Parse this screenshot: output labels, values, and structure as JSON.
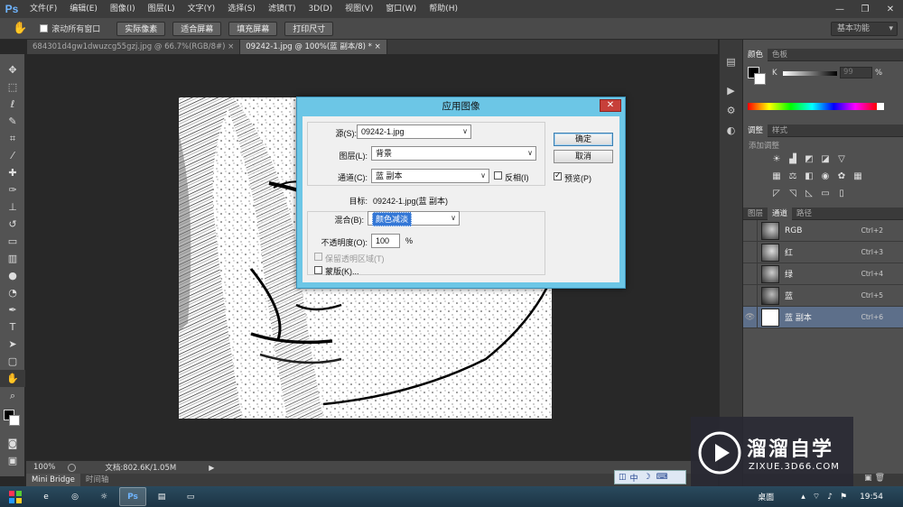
{
  "app": {
    "logo": "Ps"
  },
  "menu": [
    "文件(F)",
    "编辑(E)",
    "图像(I)",
    "图层(L)",
    "文字(Y)",
    "选择(S)",
    "滤镜(T)",
    "3D(D)",
    "视图(V)",
    "窗口(W)",
    "帮助(H)"
  ],
  "window_controls": {
    "minimize": "—",
    "restore": "❐",
    "close": "✕"
  },
  "options": {
    "scroll_all_label": "滚动所有窗口",
    "buttons": [
      "实际像素",
      "适合屏幕",
      "填充屏幕",
      "打印尺寸"
    ],
    "workspace": "基本功能"
  },
  "doc_tabs": [
    {
      "title": "684301d4gw1dwuzcg55gzj.jpg @ 66.7%(RGB/8#)",
      "close": "×"
    },
    {
      "title": "09242-1.jpg @ 100%(蓝 副本/8) *",
      "close": "×"
    }
  ],
  "tools": [
    "move-icon",
    "marquee-icon",
    "lasso-icon",
    "quick-select-icon",
    "crop-icon",
    "eyedropper-icon",
    "healing-icon",
    "brush-icon",
    "stamp-icon",
    "history-brush-icon",
    "eraser-icon",
    "gradient-icon",
    "blur-icon",
    "dodge-icon",
    "pen-icon",
    "type-icon",
    "path-select-icon",
    "shape-icon",
    "hand-icon",
    "zoom-icon"
  ],
  "status": {
    "zoom": "100%",
    "doc_info": "文档:802.6K/1.05M"
  },
  "bottom_tabs": [
    "Mini Bridge",
    "时间轴"
  ],
  "color_panel": {
    "tabs": [
      "颜色",
      "色板"
    ],
    "channel": "K",
    "value": "99",
    "unit": "%"
  },
  "adjust_panel": {
    "tabs": [
      "调整",
      "样式"
    ],
    "hint": "添加调整"
  },
  "channels_panel": {
    "tabs": [
      "图层",
      "通道",
      "路径"
    ],
    "rows": [
      {
        "name": "RGB",
        "key": "Ctrl+2",
        "visible": false
      },
      {
        "name": "红",
        "key": "Ctrl+3",
        "visible": false
      },
      {
        "name": "绿",
        "key": "Ctrl+4",
        "visible": false
      },
      {
        "name": "蓝",
        "key": "Ctrl+5",
        "visible": false
      },
      {
        "name": "蓝 副本",
        "key": "Ctrl+6",
        "visible": true
      }
    ]
  },
  "dialog": {
    "title": "应用图像",
    "close": "✕",
    "source_label": "源(S):",
    "source_value": "09242-1.jpg",
    "layer_label": "图层(L):",
    "layer_value": "背景",
    "channel_label": "通道(C):",
    "channel_value": "蓝 副本",
    "invert_label": "反相(I)",
    "target_label": "目标:",
    "target_value": "09242-1.jpg(蓝 副本)",
    "blend_label": "混合(B):",
    "blend_value": "颜色减淡",
    "opacity_label": "不透明度(O):",
    "opacity_value": "100",
    "opacity_unit": "%",
    "preserve_label": "保留透明区域(T)",
    "mask_label": "蒙版(K)...",
    "ok": "确定",
    "cancel": "取消",
    "preview_label": "预览(P)"
  },
  "taskbar": {
    "desktop_label": "桌面",
    "time": "19:54",
    "ime_label": "中"
  },
  "watermark": {
    "title": "溜溜自学",
    "url": "ZIXUE.3D66.COM"
  }
}
